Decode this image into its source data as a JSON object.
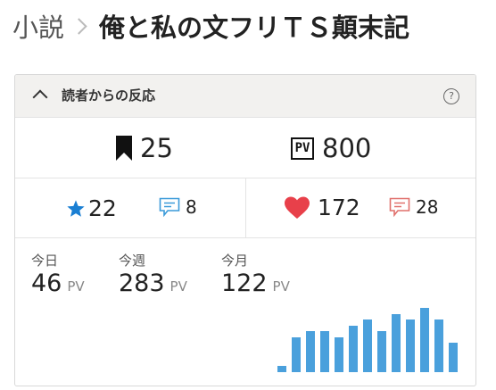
{
  "breadcrumb": {
    "category": "小説",
    "title": "俺と私の文フリＴＳ顛末記"
  },
  "panel": {
    "title": "読者からの反応",
    "help_icon": "?",
    "bookmarks": {
      "icon": "bookmark-icon",
      "count": "25"
    },
    "pageviews": {
      "icon_label": "PV",
      "count": "800"
    },
    "stars": {
      "icon": "star-icon",
      "count": "22"
    },
    "star_comments": {
      "icon": "comment-icon",
      "count": "8"
    },
    "hearts": {
      "icon": "heart-icon",
      "count": "172"
    },
    "heart_comments": {
      "icon": "comment-icon",
      "count": "28"
    },
    "periods": [
      {
        "label": "今日",
        "value": "46",
        "unit": "PV"
      },
      {
        "label": "今週",
        "value": "283",
        "unit": "PV"
      },
      {
        "label": "今月",
        "value": "122",
        "unit": "PV"
      }
    ]
  },
  "colors": {
    "accent_blue": "#1a7fd3",
    "heart_red": "#e8404a",
    "bar_blue": "#4aa0dc",
    "comment_red": "#e0706c"
  },
  "chart_data": {
    "type": "bar",
    "values": [
      1,
      6,
      7,
      7,
      6,
      8,
      9,
      7,
      10,
      9,
      11,
      9,
      5
    ],
    "ylim": [
      0,
      12
    ]
  }
}
